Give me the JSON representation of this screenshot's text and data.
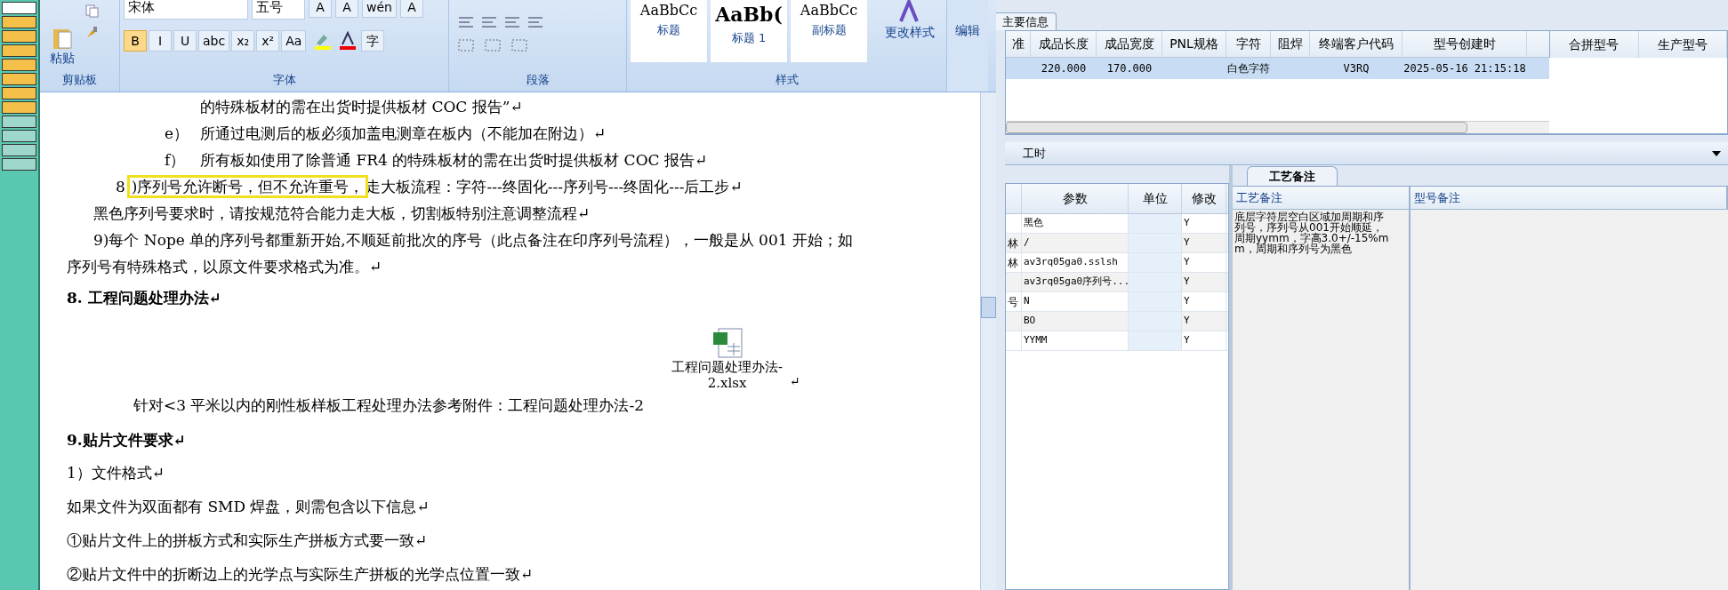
{
  "ribbon": {
    "clipboard": {
      "paste": "粘贴",
      "group": "剪贴板"
    },
    "font": {
      "name": "宋体",
      "size": "五号",
      "group": "字体",
      "buttons": [
        {
          "label": "B",
          "selected": true
        },
        {
          "label": "I",
          "selected": false
        },
        {
          "label": "U",
          "selected": false
        },
        {
          "label": "abc",
          "selected": false
        },
        {
          "label": "x₂",
          "selected": false
        },
        {
          "label": "x²",
          "selected": false
        },
        {
          "label": "Aa",
          "selected": false
        }
      ],
      "top_buttons": [
        "A",
        "A",
        "wén",
        "A"
      ],
      "char_button": "字"
    },
    "paragraph": {
      "group": "段落"
    },
    "styles": {
      "group": "样式",
      "items": [
        {
          "sample": "AaBbCc",
          "label": "标题"
        },
        {
          "sample": "AaBb(",
          "label": "标题 1"
        },
        {
          "sample": "AaBbCc",
          "label": "副标题"
        }
      ],
      "change": "更改样式"
    },
    "editing": {
      "label": "编辑"
    }
  },
  "document": {
    "paragraphs": [
      {
        "kind": "indent2",
        "text": "的特殊板材的需在出货时提供板材 COC 报告”↵"
      },
      {
        "kind": "item",
        "marker": "e）",
        "text": "所通过电测后的板必须加盖电测章在板内（不能加在附边）↵"
      },
      {
        "kind": "item",
        "marker": "f）",
        "text": "所有板如使用了除普通 FR4 的特殊板材的需在出货时提供板材 COC 报告↵"
      },
      {
        "kind": "highlighted",
        "prefix": "8",
        "highlight": ")序列号允许断号，但不允许重号，",
        "rest": "走大板流程：字符---终固化---序列号---终固化---后工步↵"
      },
      {
        "kind": "indent1",
        "text": "黑色序列号要求时，请按规范符合能力走大板，切割板特别注意调整流程↵"
      },
      {
        "kind": "indent1",
        "text": "9)每个 Nope 单的序列号都重新开始,不顺延前批次的序号（此点备注在印序列号流程），一般是从 001 开始；如"
      },
      {
        "kind": "plain",
        "text": "序列号有特殊格式，以原文件要求格式为准。↵"
      },
      {
        "kind": "heading",
        "text": "8.  工程问题处理办法↵"
      },
      {
        "kind": "attachment",
        "lines": [
          "工程问题处理办法-",
          "2.xlsx"
        ],
        "mark": "↵"
      },
      {
        "kind": "indent3",
        "text": "针对<3 平米以内的刚性板样板工程处理办法参考附件：工程问题处理办法-2"
      },
      {
        "kind": "heading",
        "text": "9.贴片文件要求↵"
      },
      {
        "kind": "spaced",
        "text": "1）文件格式↵"
      },
      {
        "kind": "spaced",
        "text": "如果文件为双面都有 SMD 焊盘，则需包含以下信息↵"
      },
      {
        "kind": "spaced",
        "text": "①贴片文件上的拼板方式和实际生产拼板方式要一致↵"
      },
      {
        "kind": "spaced",
        "text": "②贴片文件中的折断边上的光学点与实际生产拼板的光学点位置一致↵"
      }
    ]
  },
  "main_info": {
    "tab": "主要信息",
    "columns": [
      "准",
      "成品长度",
      "成品宽度",
      "PNL规格",
      "字符",
      "阻焊",
      "终端客户代码",
      "型号创建时"
    ],
    "rows": [
      {
        "selected": true,
        "cells": [
          "",
          "220.000",
          "170.000",
          "",
          "白色字符",
          "",
          "V3RQ",
          "2025-05-16 21:15:18"
        ]
      }
    ],
    "side_columns": [
      "合拼型号",
      "生产型号"
    ]
  },
  "hours_bar": {
    "label": "工时"
  },
  "params": {
    "columns": [
      "",
      "参数",
      "单位",
      "修改"
    ],
    "rows": [
      [
        "",
        "黑色",
        "",
        "Y"
      ],
      [
        "林",
        "/",
        "",
        "Y"
      ],
      [
        "林",
        "av3rq05ga0.sslsh",
        "",
        "Y"
      ],
      [
        "",
        "av3rq05ga0序列号...",
        "",
        "Y"
      ],
      [
        "号",
        "N",
        "",
        "Y"
      ],
      [
        "",
        "BO",
        "",
        "Y"
      ],
      [
        "",
        "YYMM",
        "",
        "Y"
      ]
    ]
  },
  "notes": {
    "tabs": [
      {
        "label": "工艺备注",
        "selected": true
      }
    ],
    "columns": [
      "工艺备注",
      "型号备注"
    ],
    "process_note": "底层字符层空白区域加周期和序列号，序列号从001开始顺延，周期yymm，字高3.0+/-15%mm，周期和序列号为黑色"
  }
}
